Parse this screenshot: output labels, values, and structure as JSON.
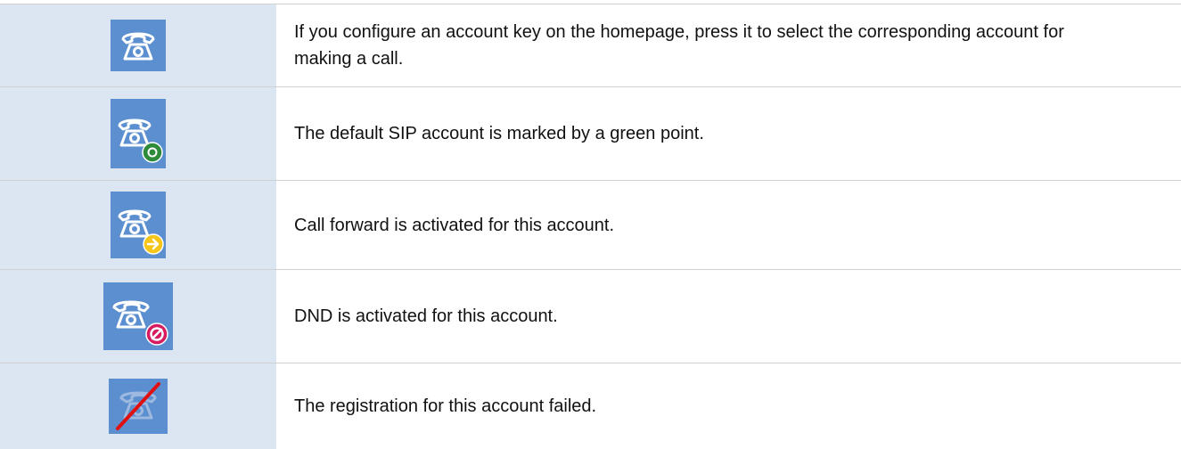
{
  "colors": {
    "icon_cell_bg": "#dce6f2",
    "icon_tile_bg": "#5b8fd0",
    "phone_glyph": "#ffffff",
    "default_badge": "#2e8b3a",
    "forward_badge": "#f5c518",
    "dnd_badge": "#d81b60",
    "failed_slash": "#e01010",
    "divider": "#d0d0d0"
  },
  "rows": [
    {
      "icon": "account-phone-icon",
      "text": "If you configure an account key on the homepage, press it to select the corresponding account for making a call."
    },
    {
      "icon": "default-account-phone-icon",
      "badge": "green-point-badge-icon",
      "text": "The default SIP account is marked by a green point."
    },
    {
      "icon": "call-forward-phone-icon",
      "badge": "forward-arrow-badge-icon",
      "text": "Call forward is activated for this account."
    },
    {
      "icon": "dnd-phone-icon",
      "badge": "no-entry-badge-icon",
      "text": "DND is activated for this account."
    },
    {
      "icon": "registration-failed-phone-icon",
      "badge": "red-slash-icon",
      "text": "The registration for this account failed."
    }
  ]
}
